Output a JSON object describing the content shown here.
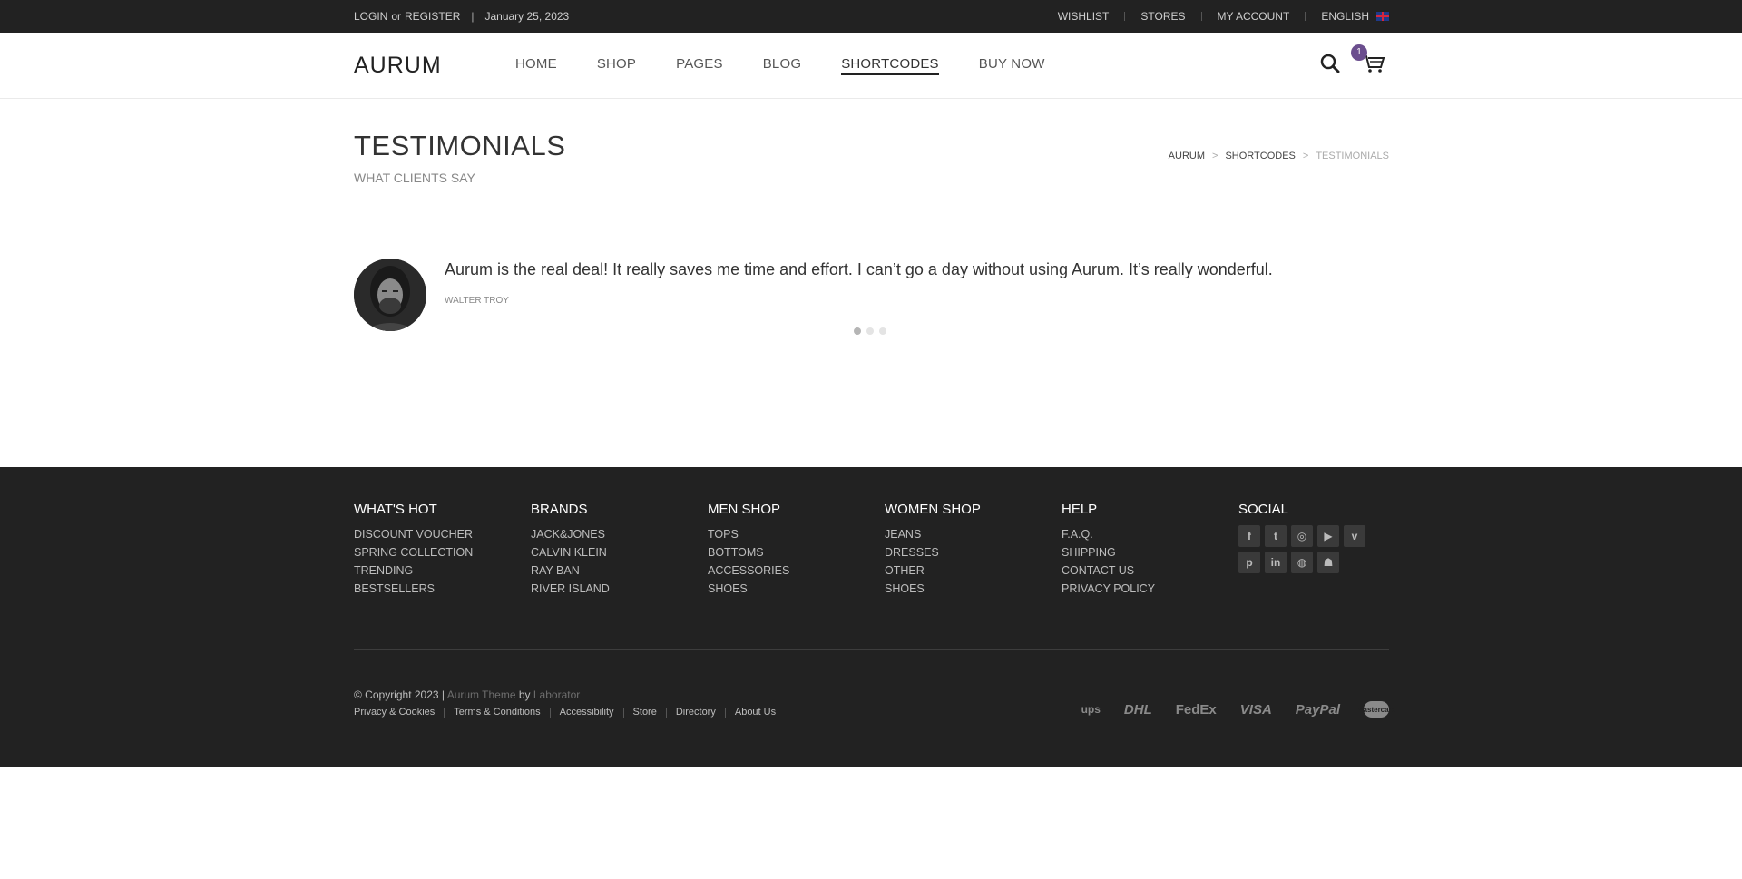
{
  "topbar": {
    "login": "LOGIN",
    "or": "or",
    "register": "REGISTER",
    "separator": "|",
    "date": "January 25, 2023",
    "links": [
      "WISHLIST",
      "STORES",
      "MY ACCOUNT"
    ],
    "language": "ENGLISH"
  },
  "header": {
    "logo": "AURUM",
    "nav": [
      "HOME",
      "SHOP",
      "PAGES",
      "BLOG",
      "SHORTCODES",
      "BUY NOW"
    ],
    "active_nav": "SHORTCODES",
    "cart_count": "1"
  },
  "page": {
    "title": "TESTIMONIALS",
    "subtitle": "WHAT CLIENTS SAY",
    "breadcrumb": [
      "AURUM",
      "SHORTCODES",
      "TESTIMONIALS"
    ],
    "breadcrumb_sep": ">"
  },
  "testimonial": {
    "quote": "Aurum is the real deal! It really saves me time and effort. I can’t go a day without using Aurum. It’s really wonderful.",
    "author": "WALTER TROY",
    "slides": 3,
    "active_slide": 1
  },
  "footer": {
    "columns": [
      {
        "title": "WHAT'S HOT",
        "links": [
          "DISCOUNT VOUCHER",
          "SPRING COLLECTION",
          "TRENDING",
          "BESTSELLERS"
        ]
      },
      {
        "title": "BRANDS",
        "links": [
          "JACK&JONES",
          "CALVIN KLEIN",
          "RAY BAN",
          "RIVER ISLAND"
        ]
      },
      {
        "title": "MEN SHOP",
        "links": [
          "TOPS",
          "BOTTOMS",
          "ACCESSORIES",
          "SHOES"
        ]
      },
      {
        "title": "WOMEN SHOP",
        "links": [
          "JEANS",
          "DRESSES",
          "OTHER",
          "SHOES"
        ]
      },
      {
        "title": "HELP",
        "links": [
          "F.A.Q.",
          "SHIPPING",
          "CONTACT US",
          "PRIVACY POLICY"
        ]
      }
    ],
    "social_title": "SOCIAL",
    "social": [
      {
        "name": "facebook-icon",
        "glyph": "f"
      },
      {
        "name": "twitter-icon",
        "glyph": "t"
      },
      {
        "name": "instagram-icon",
        "glyph": "◎"
      },
      {
        "name": "youtube-icon",
        "glyph": "▶"
      },
      {
        "name": "vimeo-icon",
        "glyph": "v"
      },
      {
        "name": "pinterest-icon",
        "glyph": "p"
      },
      {
        "name": "linkedin-icon",
        "glyph": "in"
      },
      {
        "name": "dribbble-icon",
        "glyph": "◍"
      },
      {
        "name": "snapchat-icon",
        "glyph": "☗"
      }
    ],
    "copyright_prefix": "© Copyright 2023 |",
    "theme_name": "Aurum Theme",
    "by": "by",
    "author": "Laborator",
    "bottom_links": [
      "Privacy & Cookies",
      "Terms & Conditions",
      "Accessibility",
      "Store",
      "Directory",
      "About Us"
    ],
    "payments": [
      "ups",
      "DHL",
      "FedEx",
      "VISA",
      "PayPal",
      "mastercard"
    ]
  }
}
